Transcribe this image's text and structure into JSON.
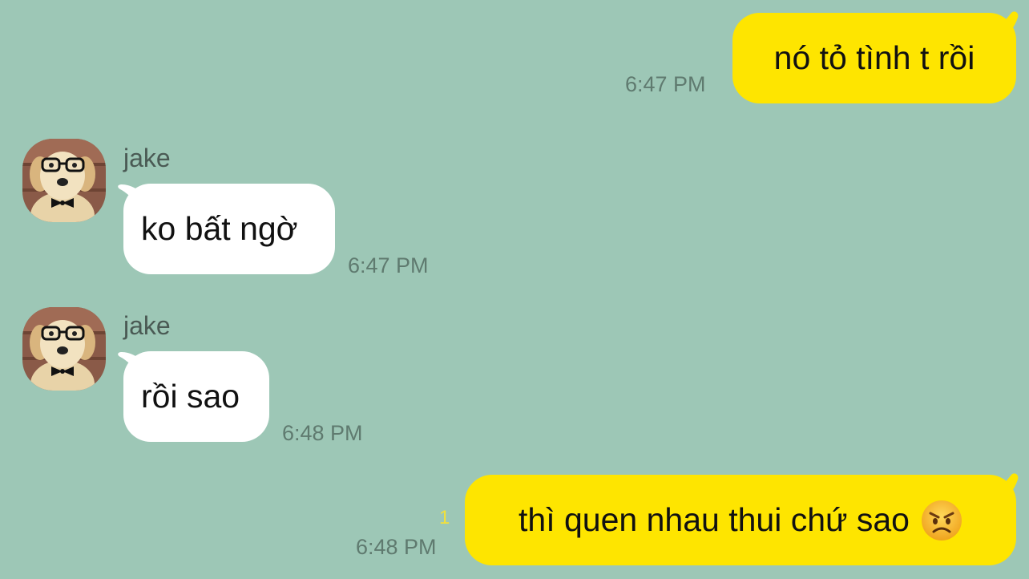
{
  "chat": {
    "messages": [
      {
        "sender": "me",
        "text": "nó tỏ tình t rồi",
        "time": "6:47 PM"
      },
      {
        "sender": "jake",
        "name": "jake",
        "text": "ko bất ngờ",
        "time": "6:47 PM"
      },
      {
        "sender": "jake",
        "name": "jake",
        "text": "rồi sao",
        "time": "6:48 PM"
      },
      {
        "sender": "me",
        "text": "thì quen nhau thui chứ sao",
        "time": "6:48 PM",
        "unread_count": "1",
        "emoji": "angry-face-icon"
      }
    ]
  },
  "theme": {
    "background": "#9dc7b6",
    "outgoing_bubble": "#fee500",
    "incoming_bubble": "#ffffff",
    "unread_count_color": "#f3e13a"
  }
}
